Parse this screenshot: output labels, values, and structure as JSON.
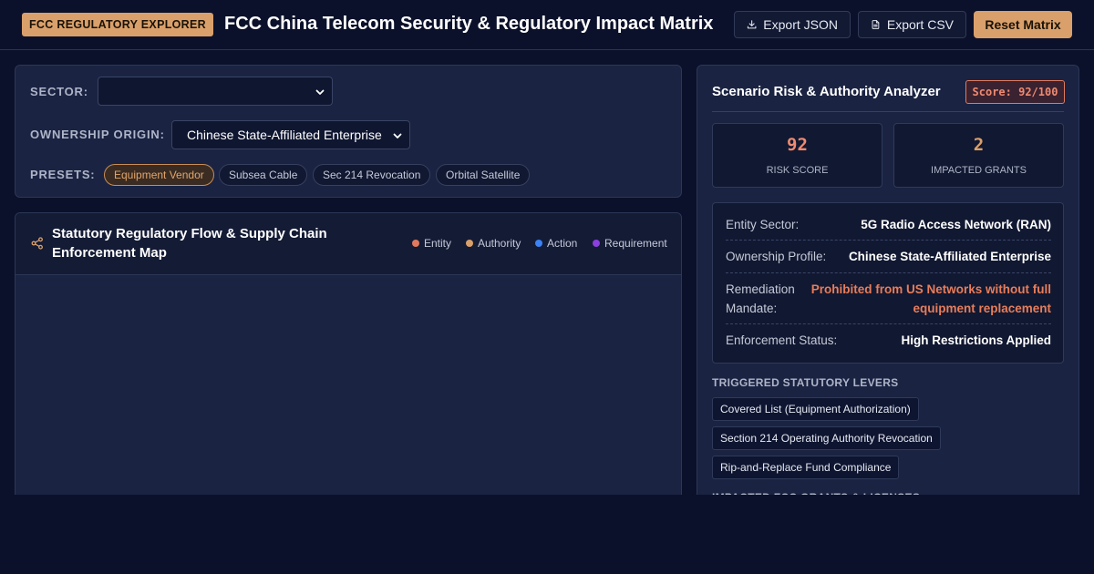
{
  "header": {
    "brand_badge": "FCC REGULATORY EXPLORER",
    "title": "FCC China Telecom Security & Regulatory Impact Matrix",
    "export_json_label": "Export JSON",
    "export_csv_label": "Export CSV",
    "reset_label": "Reset Matrix"
  },
  "controls": {
    "sector_label": "SECTOR:",
    "sector_value": "",
    "ownership_label": "OWNERSHIP ORIGIN:",
    "ownership_value": "Chinese State-Affiliated Enterprise",
    "presets_label": "PRESETS:",
    "presets": [
      {
        "label": "Equipment Vendor",
        "active": true
      },
      {
        "label": "Subsea Cable",
        "active": false
      },
      {
        "label": "Sec 214 Revocation",
        "active": false
      },
      {
        "label": "Orbital Satellite",
        "active": false
      }
    ]
  },
  "map": {
    "icon": "share-icon",
    "title": "Statutory Regulatory Flow & Supply Chain Enforcement Map",
    "legend": [
      {
        "label": "Entity",
        "color": "#e07a5f"
      },
      {
        "label": "Authority",
        "color": "#d9a06b"
      },
      {
        "label": "Action",
        "color": "#3b82f6"
      },
      {
        "label": "Requirement",
        "color": "#8b3fe0"
      }
    ]
  },
  "analyzer": {
    "title": "Scenario Risk & Authority Analyzer",
    "score_badge": "Score: 92/100",
    "risk_score": "92",
    "risk_score_label": "RISK SCORE",
    "impacted_grants": "2",
    "impacted_grants_label": "IMPACTED GRANTS",
    "details": [
      {
        "key": "Entity Sector:",
        "value": "5G Radio Access Network (RAN)"
      },
      {
        "key": "Ownership Profile:",
        "value": "Chinese State-Affiliated Enterprise"
      },
      {
        "key": "Remediation Mandate:",
        "value": "Prohibited from US Networks without full equipment replacement"
      },
      {
        "key": "Enforcement Status:",
        "value": "High Restrictions Applied"
      }
    ],
    "levers_label": "TRIGGERED STATUTORY LEVERS",
    "levers": [
      "Covered List (Equipment Authorization)",
      "Section 214 Operating Authority Revocation",
      "Rip-and-Replace Fund Compliance"
    ],
    "grants_label": "IMPACTED FCC GRANTS & LICENSES"
  },
  "colors": {
    "accent": "#d9a06b",
    "alert": "#e87d5a",
    "background": "#0b112a",
    "card": "#1a2342"
  }
}
